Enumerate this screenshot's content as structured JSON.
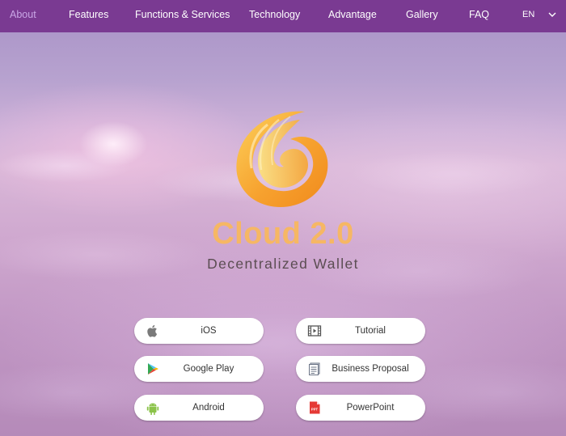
{
  "nav": {
    "items": [
      {
        "label": "About",
        "active": true
      },
      {
        "label": "Features"
      },
      {
        "label": "Functions & Services"
      },
      {
        "label": "Technology"
      },
      {
        "label": "Advantage"
      },
      {
        "label": "Gallery"
      },
      {
        "label": "FAQ"
      }
    ],
    "language": "EN"
  },
  "hero": {
    "brand": "Cloud 2.0",
    "tagline": "Decentralized Wallet"
  },
  "downloads": {
    "ios": {
      "label": "iOS",
      "icon": "apple-icon"
    },
    "google_play": {
      "label": "Google Play",
      "icon": "google-play-icon"
    },
    "android": {
      "label": "Android",
      "icon": "android-icon"
    },
    "tutorial": {
      "label": "Tutorial",
      "icon": "video-icon"
    },
    "business_proposal": {
      "label": "Business Proposal",
      "icon": "document-icon"
    },
    "powerpoint": {
      "label": "PowerPoint",
      "icon": "ppt-icon"
    }
  },
  "colors": {
    "nav_bg": "#7a3a92",
    "nav_active": "#c9a6e6",
    "brand_orange": "#f6b764",
    "tagline": "#5b4d52"
  }
}
